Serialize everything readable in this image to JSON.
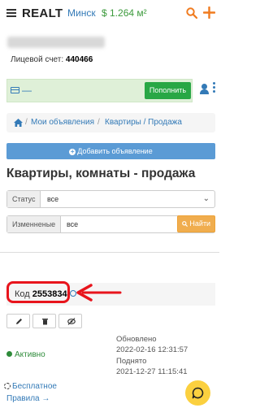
{
  "header": {
    "logo": "REALT",
    "city": "Минск",
    "rate": "$ 1.264 м²",
    "icons": [
      "menu-icon",
      "search-icon",
      "plus-icon"
    ],
    "accent_color": "#f07b1f"
  },
  "account": {
    "label": "Лицевой счет:",
    "number": "440466"
  },
  "balance": {
    "value": "—",
    "topup_label": "Пополнить"
  },
  "breadcrumb": {
    "items": [
      "Мои объявления",
      "Квартиры / Продажа"
    ]
  },
  "add_button": "Добавить объявление",
  "page_title": "Квартиры, комнаты - продажа",
  "filters": {
    "status_label": "Статус",
    "status_value": "все",
    "changed_label": "Изменненые",
    "changed_value": "все"
  },
  "find_button": "Найти",
  "listing": {
    "code_label": "Код",
    "code_value": "2553834",
    "status": "Активно",
    "updated_label": "Обновлено",
    "updated_value": "2022-02-16 12:31:57",
    "raised_label": "Поднято",
    "raised_value": "2021-12-27 11:15:41",
    "highlight_color": "#e8141c"
  },
  "footer": {
    "free_text": "Бесплатное",
    "rules_link": "Правила →"
  }
}
